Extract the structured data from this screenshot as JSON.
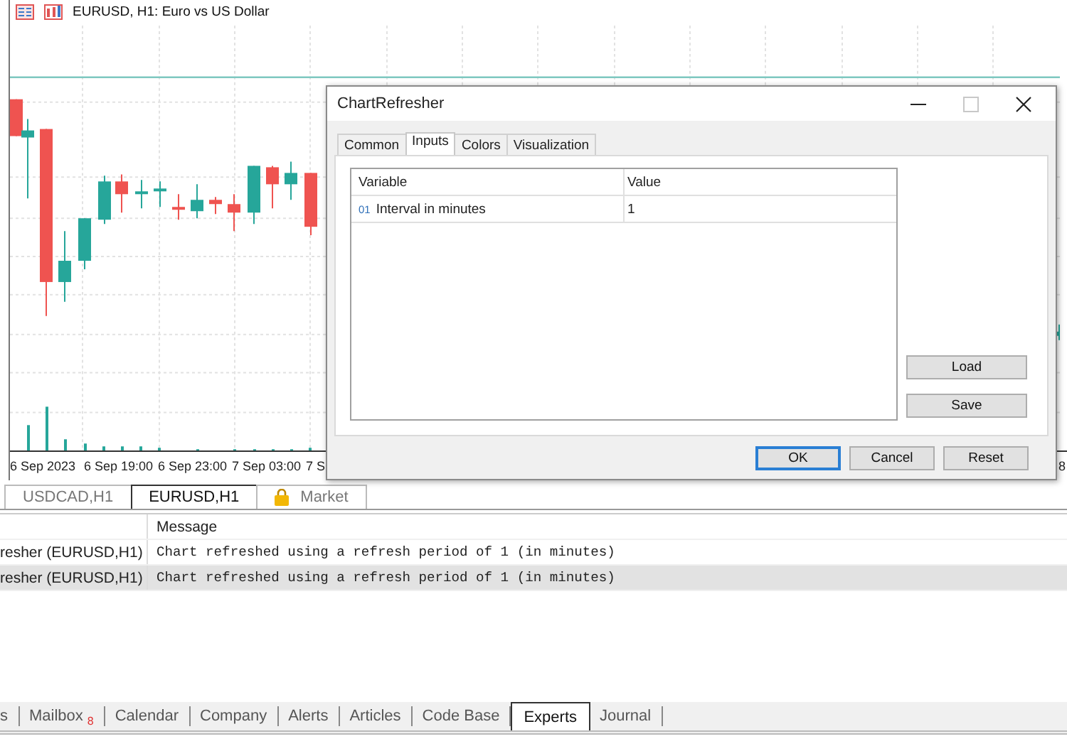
{
  "chart_window": {
    "title": "EURUSD, H1:  Euro vs US Dollar",
    "time_labels": [
      "6 Sep 2023",
      "6 Sep 19:00",
      "6 Sep 23:00",
      "7 Sep 03:00",
      "7 S"
    ],
    "edge_label": "8"
  },
  "chart_tabs": [
    {
      "label": "USDCAD,H1",
      "selected": false,
      "kind": "chart"
    },
    {
      "label": "EURUSD,H1",
      "selected": true,
      "kind": "chart"
    },
    {
      "label": "Market",
      "selected": false,
      "kind": "market"
    }
  ],
  "log": {
    "message_header": "Message",
    "rows": [
      {
        "source": "resher (EURUSD,H1)",
        "message": "Chart refreshed using a refresh period of 1 (in minutes)",
        "selected": false
      },
      {
        "source": "resher (EURUSD,H1)",
        "message": "Chart refreshed using a refresh period of 1 (in minutes)",
        "selected": true
      }
    ]
  },
  "bottom_tabs": [
    {
      "label": "s",
      "selected": false
    },
    {
      "label": "Mailbox",
      "badge": "8",
      "selected": false
    },
    {
      "label": "Calendar",
      "selected": false
    },
    {
      "label": "Company",
      "selected": false
    },
    {
      "label": "Alerts",
      "selected": false
    },
    {
      "label": "Articles",
      "selected": false
    },
    {
      "label": "Code Base",
      "selected": false
    },
    {
      "label": "Experts",
      "selected": true
    },
    {
      "label": "Journal",
      "selected": false
    }
  ],
  "dialog": {
    "title": "ChartRefresher",
    "tabs": [
      {
        "label": "Common",
        "selected": false
      },
      {
        "label": "Inputs",
        "selected": true
      },
      {
        "label": "Colors",
        "selected": false
      },
      {
        "label": "Visualization",
        "selected": false
      }
    ],
    "table": {
      "columns": [
        "Variable",
        "Value"
      ],
      "rows": [
        {
          "type_tag": "01",
          "variable": "Interval in minutes",
          "value": "1"
        }
      ]
    },
    "side_buttons": [
      "Load",
      "Save"
    ],
    "buttons": [
      {
        "label": "OK",
        "default": true
      },
      {
        "label": "Cancel",
        "default": false
      },
      {
        "label": "Reset",
        "default": false
      }
    ]
  }
}
